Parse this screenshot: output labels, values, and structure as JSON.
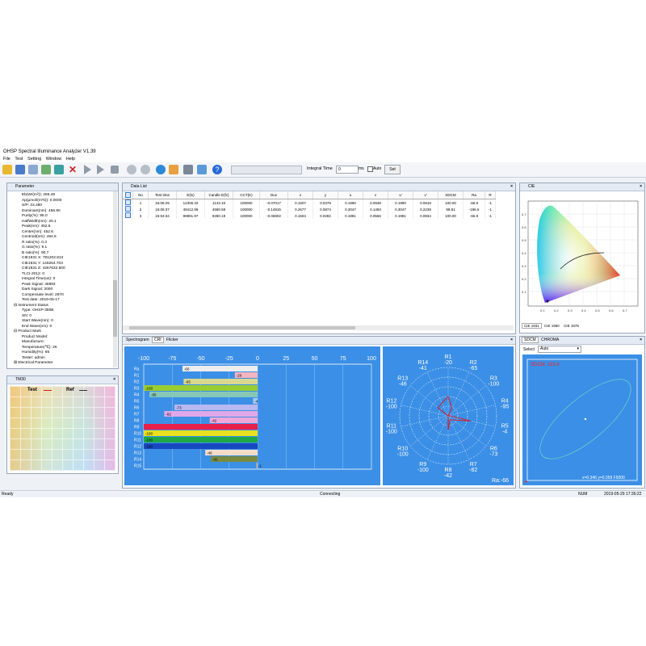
{
  "app": {
    "title": "OHSP Spectral Illuminance Analyzer V1.39",
    "menu": [
      "File",
      "Test",
      "Setting",
      "Window",
      "Help"
    ],
    "integral_label": "Integral Time",
    "integral_value": "0",
    "integral_unit": "ms",
    "auto_label": "Auto",
    "set_label": "Set"
  },
  "parameter_panel": {
    "title": "Parameter",
    "params": [
      "Eb(W/(m²)): 265.49",
      "Ap(μmol/(m²s)): 0.0000",
      "S/P: 22.480",
      "Dominant(nm): 456.90",
      "Purity(%): 95.0",
      "HalfWidth(nm): 20.1",
      "Peak(nm): 452.6",
      "Center(nm): 452.6",
      "Centroid(nm): 494.6",
      "R ratio(%): 0.3",
      "G ratio(%): 9.1",
      "B ratio(%): 90.7",
      "CIE1931 X: 781202.813",
      "CIE1931 Y: 146254.703",
      "CIE1931 Z: 4267632.500",
      "TLCI-2012: 0",
      "Integral Time(us): 0",
      "Peak Signal: 46993",
      "Dark Signal: 2000",
      "Compensate level: 2870",
      "Test date: 2019-05-17"
    ],
    "instrument_group": "Instrument Status",
    "instrument": [
      "Type: OHSP-350B",
      "SN: 0",
      "Start Wave(nm): 0",
      "End Wave(nm): 0"
    ],
    "product_group": "Product Mark",
    "product": [
      "Product Model:",
      "Manufacture:",
      "Temperature(℃): 26",
      "Humidity(%): 65",
      "Tester: admin"
    ],
    "electrical_group": "Electrical Parameter"
  },
  "tm30_panel": {
    "title": "TM30",
    "test_label": "Test",
    "ref_label": "Ref"
  },
  "data_list": {
    "title": "Data List",
    "columns": [
      "No",
      "Test time",
      "E(lx)",
      "Candle E(fc)",
      "CCT(K)",
      "Duv",
      "x",
      "y",
      "u",
      "v",
      "u'",
      "v'",
      "SDCM",
      "Ra",
      "R"
    ],
    "rows": [
      [
        "1",
        "16:06:29",
        "12305.32",
        "1143.19",
        "100000",
        "-0.07017",
        "0.1507",
        "0.0379",
        "0.1990",
        "0.0948",
        "0.1990",
        "0.0818",
        "100.00",
        "-66.5",
        "-1"
      ],
      [
        "2",
        "16:06:37",
        "49412.99",
        "4590.58",
        "100000",
        "-0.14915",
        "0.2677",
        "0.0874",
        "0.3047",
        "0.1493",
        "0.3047",
        "0.2239",
        "98.81",
        "-196.6",
        "-1"
      ],
      [
        "3",
        "15:53:34",
        "99891.97",
        "9280.19",
        "100000",
        "-0.06902",
        "0.1504",
        "0.0282",
        "0.1981",
        "0.0556",
        "0.1981",
        "0.0834",
        "100.00",
        "-65.9",
        "-1"
      ]
    ]
  },
  "cie_panel": {
    "title": "CIE",
    "tabs": [
      "CIE 1931",
      "CIE 1960",
      "CIE 1976"
    ]
  },
  "spectro_tabs": [
    "Spectrogram",
    "CRI",
    "Flicker"
  ],
  "cri_bar": {
    "x_ticks": [
      "-100",
      "-75",
      "-50",
      "-25",
      "0",
      "25",
      "50",
      "75",
      "100"
    ],
    "rows": [
      {
        "label": "Ra",
        "value": -66,
        "text": "-66",
        "color": "#ededed"
      },
      {
        "label": "R1",
        "value": -20,
        "text": "-20",
        "color": "#f4b4c0"
      },
      {
        "label": "R2",
        "value": -65,
        "text": "-65",
        "color": "#d8d890"
      },
      {
        "label": "R3",
        "value": -100,
        "text": "-100",
        "color": "#9acd32"
      },
      {
        "label": "R4",
        "value": -95,
        "text": "-95",
        "color": "#86c8b8"
      },
      {
        "label": "R5",
        "value": -4,
        "text": "-4",
        "color": "#a8c8f0"
      },
      {
        "label": "R6",
        "value": -73,
        "text": "-73",
        "color": "#b8b8f0"
      },
      {
        "label": "R7",
        "value": -82,
        "text": "-82",
        "color": "#e0a8e8"
      },
      {
        "label": "R8",
        "value": -42,
        "text": "-42",
        "color": "#f0a8d8"
      },
      {
        "label": "R9",
        "value": -100,
        "text": "",
        "color": "#e8204a"
      },
      {
        "label": "R10",
        "value": -100,
        "text": "-100",
        "color": "#e8e020"
      },
      {
        "label": "R11",
        "value": -100,
        "text": "-100",
        "color": "#20a848"
      },
      {
        "label": "R12",
        "value": -100,
        "text": "-100",
        "color": "#1848c0"
      },
      {
        "label": "R13",
        "value": -46,
        "text": "-46",
        "color": "#f4dcc8"
      },
      {
        "label": "R14",
        "value": -41,
        "text": "-41",
        "color": "#7a8a40"
      },
      {
        "label": "R15",
        "value": -1,
        "text": "-1",
        "color": "#d8b8a0"
      }
    ]
  },
  "cri_radar": {
    "points": [
      {
        "name": "R1",
        "value": -20
      },
      {
        "name": "R2",
        "value": -65
      },
      {
        "name": "R3",
        "value": -100
      },
      {
        "name": "R4",
        "value": -95
      },
      {
        "name": "R5",
        "value": -4
      },
      {
        "name": "R6",
        "value": -73
      },
      {
        "name": "R7",
        "value": -82
      },
      {
        "name": "R8",
        "value": -42
      },
      {
        "name": "R9",
        "value": -100
      },
      {
        "name": "R10",
        "value": -100
      },
      {
        "name": "R11",
        "value": -100
      },
      {
        "name": "R12",
        "value": -100
      },
      {
        "name": "R13",
        "value": -46
      },
      {
        "name": "R14",
        "value": -41
      }
    ],
    "ra_text": "Ra:-66"
  },
  "sdcm_panel": {
    "tabs": [
      "SDCM",
      "CHROMA"
    ],
    "select_label": "Select",
    "select_value": "Auto",
    "sdcm_text": "SDCM: 115.4",
    "coord_text": "x=0.346 y=0.359 F5000"
  },
  "status": {
    "left": "Ready",
    "center": "Connecting",
    "num": "NUM",
    "datetime": "2019-05-29 17:36:22"
  }
}
